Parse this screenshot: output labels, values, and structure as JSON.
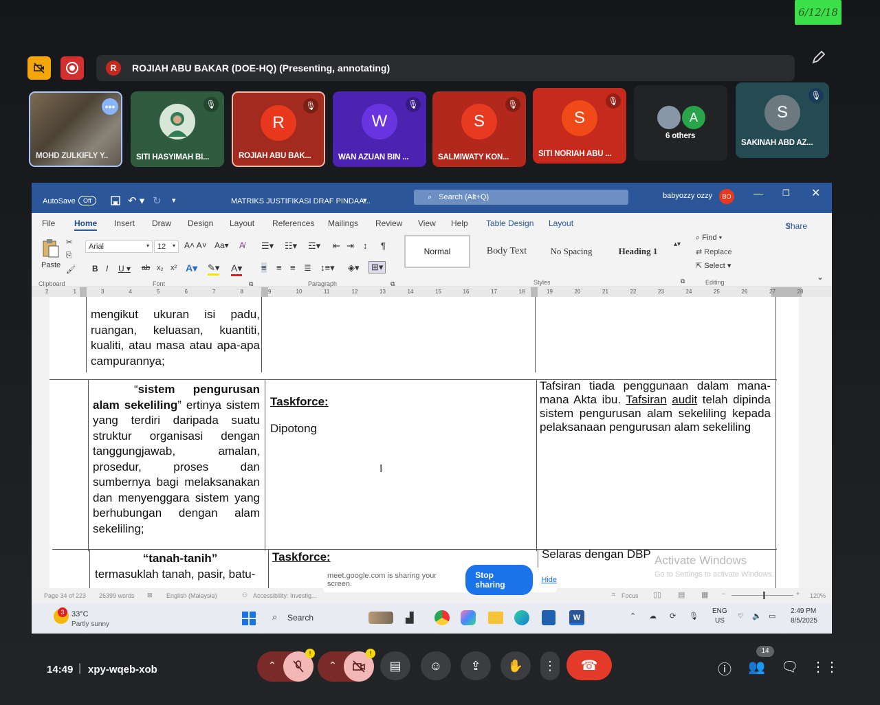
{
  "sticky_note": "6/12/18",
  "meet": {
    "presenter_avatar": "R",
    "presenter_text": "ROJIAH ABU BAKAR (DOE-HQ) (Presenting, annotating)",
    "participants": [
      {
        "name": "MOHD ZULKIFLY Y..",
        "initial": "",
        "color": "#6b5a48"
      },
      {
        "name": "SITI HASYIMAH BI...",
        "initial": "",
        "color": "#2f5b3f"
      },
      {
        "name": "ROJIAH ABU BAK...",
        "initial": "R",
        "color": "#a32a1e"
      },
      {
        "name": "WAN AZUAN BIN ...",
        "initial": "W",
        "color": "#4b23b0"
      },
      {
        "name": "SALMIWATY KON...",
        "initial": "S",
        "color": "#b2281c"
      },
      {
        "name": "SITI NORIAH ABU ...",
        "initial": "S",
        "color": "#c52a1c"
      },
      {
        "name": "6 others",
        "initial": "A",
        "color": "#222325"
      },
      {
        "name": "SAKINAH ABD AZ...",
        "initial": "S",
        "color": "#244a52"
      }
    ],
    "time": "14:49",
    "meeting_code": "xpy-wqeb-xob",
    "people_count": "14"
  },
  "word": {
    "autosave_label": "AutoSave",
    "autosave_state": "Off",
    "doc_title": "MATRIKS JUSTIFIKASI DRAF PINDAA...",
    "search_placeholder": "Search (Alt+Q)",
    "user": "babyozzy ozzy",
    "user_initials": "BO",
    "menu": [
      "File",
      "Home",
      "Insert",
      "Draw",
      "Design",
      "Layout",
      "References",
      "Mailings",
      "Review",
      "View",
      "Help",
      "Table Design",
      "Layout"
    ],
    "share_label": "Share",
    "ribbon": {
      "paste": "Paste",
      "font": "Arial",
      "size": "12",
      "styles": [
        "Normal",
        "Body Text",
        "No Spacing",
        "Heading 1"
      ],
      "find": "Find",
      "replace": "Replace",
      "select": "Select",
      "groups": [
        "Clipboard",
        "Font",
        "Paragraph",
        "Styles",
        "Editing"
      ]
    },
    "ruler_ticks": [
      "2",
      "1",
      "3",
      "4",
      "5",
      "6",
      "7",
      "8",
      "9",
      "10",
      "11",
      "12",
      "13",
      "14",
      "15",
      "16",
      "17",
      "18",
      "19",
      "20",
      "21",
      "22",
      "23",
      "24",
      "25",
      "26",
      "27",
      "28"
    ],
    "table": {
      "r1c1": "mengikut ukuran isi padu, ruangan, keluasan, kuantiti, kualiti, atau masa atau apa-apa campurannya;",
      "r2c1_quote_open": "“",
      "r2c1_term": "sistem pengurusan alam sekeliling",
      "r2c1_rest": "” ertinya sistem yang terdiri daripada suatu struktur organisasi dengan tanggungjawab, amalan, prosedur, proses dan sumbernya bagi melaksanakan dan menyenggara sistem yang berhubungan dengan alam sekeliling;",
      "r2c2_head": "Taskforce:",
      "r2c2_body": "Dipotong",
      "r2c3_a": "Tafsiran tiada penggunaan dalam mana-mana Akta ibu. ",
      "r2c3_link1": "Tafsiran",
      "r2c3_link2": "audit",
      "r2c3_b": " telah dipinda sistem pengurusan alam sekeliling kepada pelaksanaan pengurusan alam sekeliling",
      "r3c1_term": "“tanah-tanih”",
      "r3c1_rest": "termasuklah tanah, pasir, batu-",
      "r3c2_head": "Taskforce:",
      "r3c3": "Selaras dengan DBP"
    },
    "watermark_1": "Activate Windows",
    "watermark_2": "Go to Settings to activate Windows.",
    "status": {
      "page": "Page 34 of 223",
      "words": "26399 words",
      "lang": "English (Malaysia)",
      "access": "Accessibility: Investig...",
      "focus": "Focus",
      "zoom": "120%"
    },
    "share_banner": {
      "text": "meet.google.com is sharing your screen.",
      "stop": "Stop sharing",
      "hide": "Hide"
    },
    "taskbar": {
      "temp": "33°C",
      "weather": "Partly sunny",
      "badge": "3",
      "search": "Search",
      "lang1": "ENG",
      "lang2": "US",
      "clock": "2:49 PM",
      "date": "8/5/2025"
    }
  }
}
